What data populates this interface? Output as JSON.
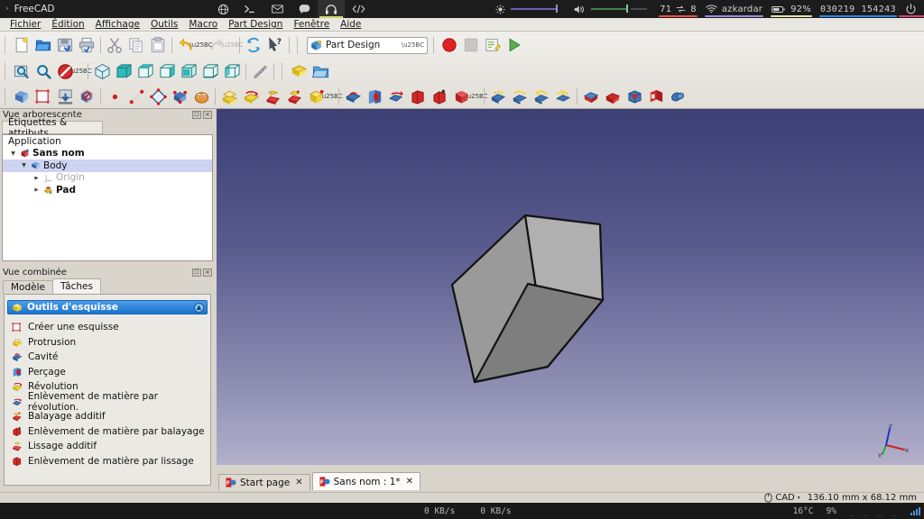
{
  "system_bar": {
    "arrow": "›",
    "app_name": "FreeCAD",
    "tray_icons": [
      "globe-icon",
      "terminal-icon",
      "mail-icon",
      "chat-icon",
      "headphones-icon",
      "code-icon"
    ],
    "active_tray_index": 4,
    "brightness_label": "brightness-slider",
    "volume_label": "volume-slider",
    "net_down": "71",
    "net_up": "8",
    "wifi_ssid": "azkardar",
    "battery_pct": "92%",
    "date": "030219",
    "time": "154243",
    "power_icon": "power-icon",
    "accent_red": "#e8533f",
    "accent_purple": "#a189e0",
    "accent_yellow": "#e8e4a0",
    "accent_blue": "#2b87e8",
    "accent_pink": "#e0407a"
  },
  "menubar": {
    "items": [
      "Fichier",
      "Édition",
      "Affichage",
      "Outils",
      "Macro",
      "Part Design",
      "Fenêtre",
      "Aide"
    ]
  },
  "toolbars": {
    "workbench_selected": "Part Design",
    "row1_buttons": [
      "new-document-icon",
      "open-document-icon",
      "save-document-icon",
      "print-icon",
      "cut-icon",
      "copy-icon",
      "paste-icon",
      "undo-icon",
      "undo-dropdown-caret",
      "redo-icon",
      "redo-dropdown-caret",
      "refresh-icon",
      "whats-this-icon"
    ],
    "row1_after": [
      "record-macro-icon",
      "stop-macro-icon",
      "edit-macro-icon",
      "execute-macro-icon"
    ],
    "row2_buttons": [
      "fit-all-icon",
      "fit-selection-icon",
      "no-draw-style-icon",
      "draw-style-caret",
      "axonometric-icon",
      "front-view-icon",
      "top-view-icon",
      "right-view-icon",
      "rear-view-icon",
      "bottom-view-icon",
      "left-view-icon",
      "measure-icon",
      "part-icon",
      "group-icon"
    ],
    "row3_buttons": [
      "create-body-icon",
      "create-sketch-icon",
      "attach-sketch-icon",
      "validate-sketch-icon",
      "datum-point-icon",
      "datum-line-icon",
      "datum-plane-icon",
      "local-coordinate-icon",
      "shape-binder-icon",
      "pad-icon",
      "revolution-icon",
      "additive-loft-icon",
      "additive-pipe-icon",
      "additive-primitive-icon",
      "primitive-caret",
      "pocket-icon",
      "hole-icon",
      "groove-icon",
      "subtractive-loft-icon",
      "subtractive-pipe-icon",
      "subtractive-primitive-icon",
      "subtractive-caret",
      "fillet-icon",
      "chamfer-icon",
      "draft-icon",
      "thickness-icon",
      "mirrored-icon",
      "linear-pattern-icon",
      "polar-pattern-icon",
      "multi-transform-icon",
      "boolean-icon"
    ]
  },
  "tree_panel": {
    "title": "Vue arborescente",
    "subtab": "Étiquettes & attributs",
    "root_label": "Application",
    "nodes": [
      {
        "label": "Sans nom",
        "depth": 0,
        "expander": "down",
        "icon": "document-icon",
        "bold": true,
        "selected": false,
        "dim": false
      },
      {
        "label": "Body",
        "depth": 1,
        "expander": "down",
        "icon": "body-icon",
        "bold": false,
        "selected": true,
        "dim": false
      },
      {
        "label": "Origin",
        "depth": 2,
        "expander": "right",
        "icon": "origin-icon",
        "bold": false,
        "selected": false,
        "dim": true
      },
      {
        "label": "Pad",
        "depth": 2,
        "expander": "right",
        "icon": "pad-icon",
        "bold": true,
        "selected": false,
        "dim": false
      }
    ]
  },
  "combined_panel": {
    "title": "Vue combinée",
    "tabs": [
      {
        "label": "Modèle",
        "active": false
      },
      {
        "label": "Tâches",
        "active": true
      }
    ],
    "task_header": "Outils d'esquisse",
    "task_items": [
      {
        "label": "Créer une esquisse",
        "icon": "create-sketch-icon"
      },
      {
        "label": "Protrusion",
        "icon": "pad-icon"
      },
      {
        "label": "Cavité",
        "icon": "pocket-icon"
      },
      {
        "label": "Perçage",
        "icon": "hole-icon"
      },
      {
        "label": "Révolution",
        "icon": "revolution-icon"
      },
      {
        "label": "Enlèvement de matière par révolution.",
        "icon": "groove-icon"
      },
      {
        "label": "Balayage additif",
        "icon": "additive-pipe-icon"
      },
      {
        "label": "Enlèvement de matière par balayage",
        "icon": "subtractive-pipe-icon"
      },
      {
        "label": "Lissage additif",
        "icon": "additive-loft-icon"
      },
      {
        "label": "Enlèvement de matière par lissage",
        "icon": "subtractive-loft-icon"
      }
    ]
  },
  "view": {
    "tabs": [
      {
        "label": "Start page",
        "active": false,
        "close": "✕"
      },
      {
        "label": "Sans nom : 1*",
        "active": true,
        "close": "✕"
      }
    ],
    "axis_labels": {
      "x": "x",
      "y": "y",
      "z": "z"
    }
  },
  "status_bar": {
    "nav_style": "CAD",
    "nav_caret": "▾",
    "dimensions": "136.10 mm x 68.12 mm"
  },
  "taskbar": {
    "net_down": "0 KB/s",
    "net_up": "0 KB/s",
    "temperature": "16°C",
    "cpu": "9%",
    "graph": "_ _ _ _",
    "signal_icon": "signal-icon"
  }
}
